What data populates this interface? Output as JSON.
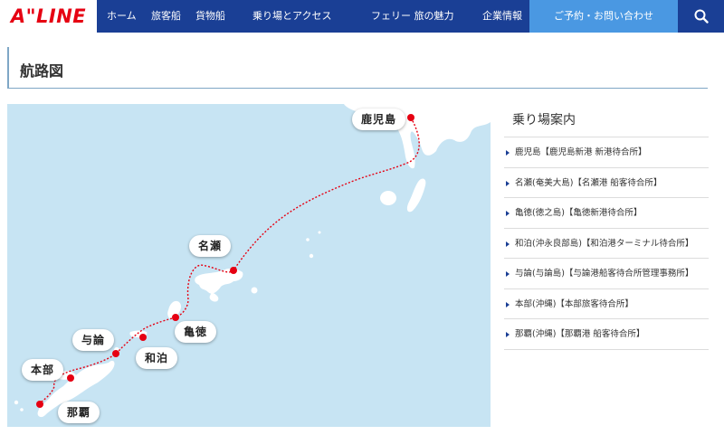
{
  "header": {
    "logo": "A\"LINE",
    "nav": [
      {
        "label": "ホーム",
        "name": "nav-home"
      },
      {
        "label": "旅客船",
        "name": "nav-passenger-ships"
      },
      {
        "label": "貨物船",
        "name": "nav-cargo-ships"
      },
      {
        "label": "乗り場とアクセス",
        "name": "nav-terminals-access"
      },
      {
        "label": "フェリー 旅の魅力",
        "name": "nav-ferry-travel"
      },
      {
        "label": "企業情報",
        "name": "nav-company-info"
      }
    ],
    "cta_label": "ご予約・お問い合わせ",
    "search_icon": "search-icon"
  },
  "page": {
    "title": "航路図"
  },
  "map": {
    "ports": [
      {
        "label": "鹿児島",
        "name": "port-kagoshima"
      },
      {
        "label": "名瀬",
        "name": "port-naze"
      },
      {
        "label": "亀徳",
        "name": "port-kametoku"
      },
      {
        "label": "和泊",
        "name": "port-wadomari"
      },
      {
        "label": "与論",
        "name": "port-yoron"
      },
      {
        "label": "本部",
        "name": "port-motobu"
      },
      {
        "label": "那覇",
        "name": "port-naha"
      }
    ],
    "colors": {
      "sea": "#c7e4f3",
      "land": "#ffffff",
      "route": "#e60012",
      "port": "#e60012"
    }
  },
  "sidebar": {
    "title": "乗り場案内",
    "items": [
      {
        "label": "鹿児島【鹿児島新港 新港待合所】"
      },
      {
        "label": "名瀬(奄美大島)【名瀬港 船客待合所】"
      },
      {
        "label": "亀徳(徳之島)【亀徳新港待合所】"
      },
      {
        "label": "和泊(沖永良部島)【和泊港ターミナル待合所】"
      },
      {
        "label": "与論(与論島)【与論港船客待合所管理事務所】"
      },
      {
        "label": "本部(沖縄)【本部旅客待合所】"
      },
      {
        "label": "那覇(沖縄)【那覇港 船客待合所】"
      }
    ]
  }
}
